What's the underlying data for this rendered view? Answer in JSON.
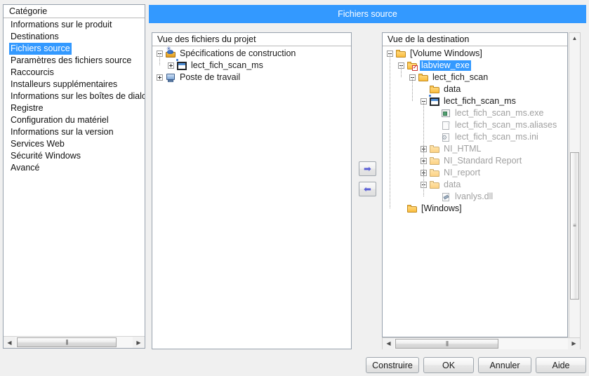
{
  "window": {
    "title": "Fichiers source",
    "title_bg": "#3399ff"
  },
  "category_panel": {
    "header": "Catégorie",
    "selected_index": 2,
    "items": [
      "Informations sur le produit",
      "Destinations",
      "Fichiers source",
      "Paramètres des fichiers source",
      "Raccourcis",
      "Installeurs supplémentaires",
      "Informations sur les boîtes de dialog",
      "Registre",
      "Configuration du matériel",
      "Informations sur la version",
      "Services Web",
      "Sécurité Windows",
      "Avancé"
    ],
    "scrollbar": {
      "left_arrow": "◀",
      "right_arrow": "▶",
      "grip": "|||"
    }
  },
  "project_tree": {
    "header": "Vue des fichiers du projet",
    "nodes": [
      {
        "label": "Spécifications de construction",
        "icon": "buildspec-icon",
        "toggle": "minus",
        "depth": 0,
        "dim": false
      },
      {
        "label": "lect_fich_scan_ms",
        "icon": "vi-icon",
        "toggle": "plus",
        "depth": 1,
        "dim": false
      },
      {
        "label": "Poste de travail",
        "icon": "computer-icon",
        "toggle": "plus",
        "depth": 0,
        "dim": false
      }
    ]
  },
  "dest_tree": {
    "header": "Vue de la destination",
    "nodes": [
      {
        "label": "[Volume Windows]",
        "icon": "folder-icon",
        "toggle": "minus",
        "depth": 0,
        "dim": false,
        "selected": false
      },
      {
        "label": "labview_exe",
        "icon": "folder-check-icon",
        "toggle": "minus",
        "depth": 1,
        "dim": false,
        "selected": true
      },
      {
        "label": "lect_fich_scan",
        "icon": "folder-icon",
        "toggle": "minus",
        "depth": 2,
        "dim": false,
        "selected": false
      },
      {
        "label": "data",
        "icon": "folder-icon",
        "toggle": "none",
        "depth": 3,
        "dim": false,
        "selected": false
      },
      {
        "label": "lect_fich_scan_ms",
        "icon": "vi-icon",
        "toggle": "minus",
        "depth": 3,
        "dim": false,
        "selected": false
      },
      {
        "label": "lect_fich_scan_ms.exe",
        "icon": "exe-icon",
        "toggle": "none",
        "depth": 4,
        "dim": true,
        "selected": false
      },
      {
        "label": "lect_fich_scan_ms.aliases",
        "icon": "doc-icon",
        "toggle": "none",
        "depth": 4,
        "dim": true,
        "selected": false
      },
      {
        "label": "lect_fich_scan_ms.ini",
        "icon": "ini-icon",
        "toggle": "none",
        "depth": 4,
        "dim": true,
        "selected": false
      },
      {
        "label": "NI_HTML",
        "icon": "folder-icon",
        "toggle": "plus",
        "depth": 3,
        "dim": true,
        "selected": false
      },
      {
        "label": "NI_Standard Report",
        "icon": "folder-icon",
        "toggle": "plus",
        "depth": 3,
        "dim": true,
        "selected": false
      },
      {
        "label": "NI_report",
        "icon": "folder-icon",
        "toggle": "plus",
        "depth": 3,
        "dim": true,
        "selected": false
      },
      {
        "label": "data",
        "icon": "folder-icon",
        "toggle": "minus",
        "depth": 3,
        "dim": true,
        "selected": false
      },
      {
        "label": "lvanlys.dll",
        "icon": "dll-icon",
        "toggle": "none",
        "depth": 4,
        "dim": true,
        "selected": false
      },
      {
        "label": "[Windows]",
        "icon": "folder-icon",
        "toggle": "none",
        "depth": 1,
        "dim": false,
        "selected": false
      }
    ],
    "vscrollbar": {
      "up_arrow": "▲",
      "down_arrow": "▼",
      "grip": "≡"
    },
    "hscrollbar": {
      "left_arrow": "◀",
      "right_arrow": "▶",
      "grip": "|||"
    }
  },
  "transfer_buttons": {
    "add": "➡",
    "remove": "⬅",
    "accent": "#5b60d6"
  },
  "footer_buttons": {
    "build": "Construire",
    "ok": "OK",
    "cancel": "Annuler",
    "help": "Aide"
  }
}
